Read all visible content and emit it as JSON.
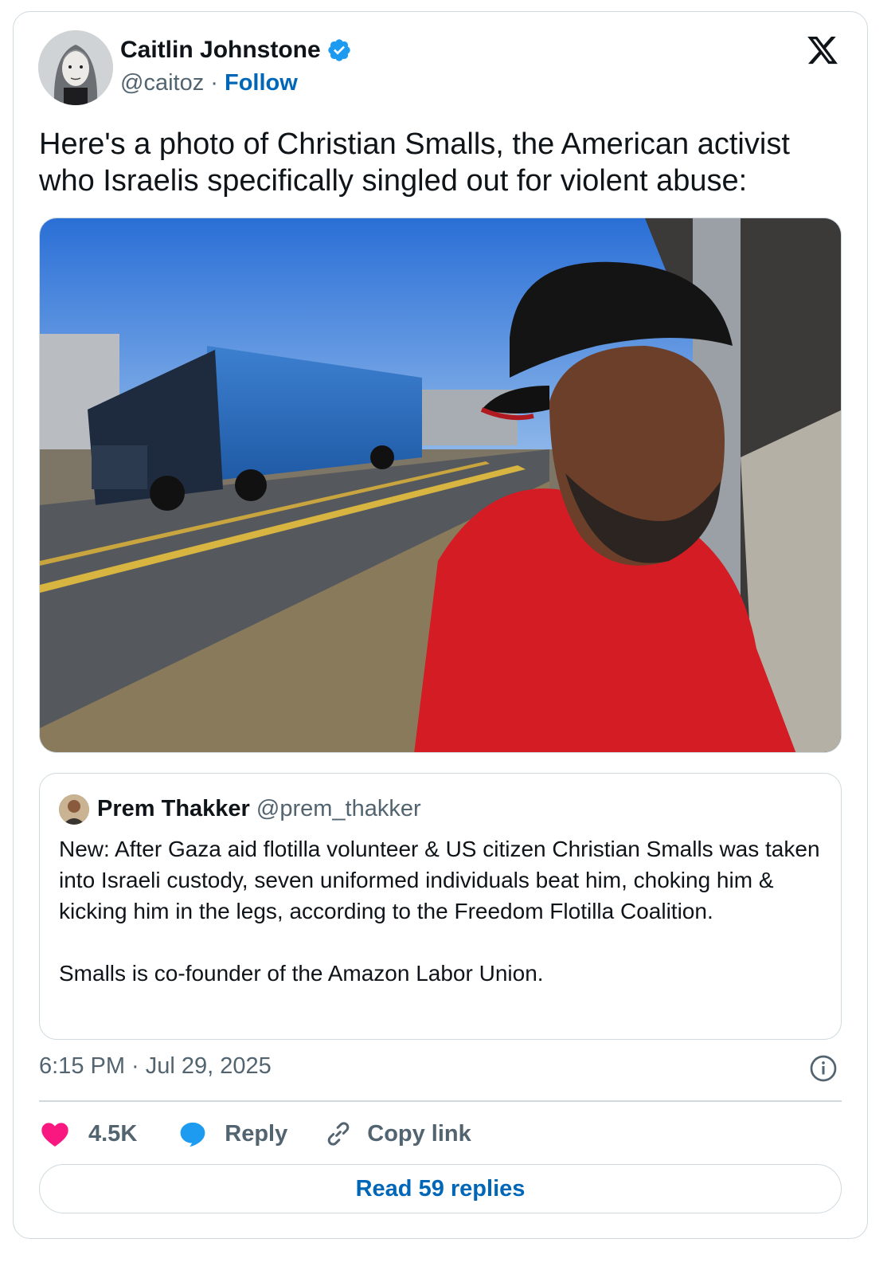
{
  "author": {
    "name": "Caitlin Johnstone",
    "handle": "@caitoz",
    "separator": " · ",
    "follow_label": "Follow",
    "verified_icon": "verified-badge-icon"
  },
  "platform_icon": "x-logo-icon",
  "tweet": {
    "text": "Here's a photo of Christian Smalls, the American activist who Israelis specifically singled out for violent abuse:"
  },
  "quoted_tweet": {
    "name": "Prem Thakker",
    "handle": "@prem_thakker",
    "text": "New: After Gaza aid flotilla volunteer & US citizen Christian Smalls was taken into Israeli custody, seven uniformed individuals beat him, choking him & kicking him in the legs, according to the Freedom Flotilla Coalition.\n\nSmalls is co-founder of the Amazon Labor Union."
  },
  "timestamp": "6:15 PM · Jul 29, 2025",
  "actions": {
    "like_count": "4.5K",
    "reply_label": "Reply",
    "copy_label": "Copy link"
  },
  "read_replies_label": "Read 59 replies",
  "colors": {
    "link": "#0067b8",
    "like": "#f91880",
    "reply": "#1d9bf0",
    "muted": "#536471",
    "border": "#cfd9de"
  }
}
